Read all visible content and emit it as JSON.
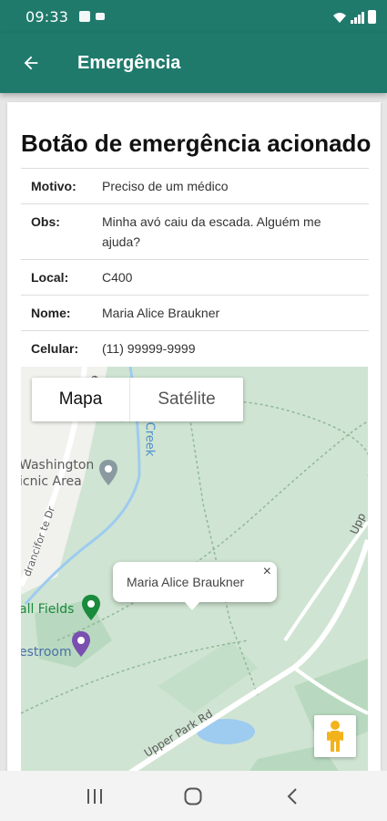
{
  "status_bar": {
    "time": "09:33"
  },
  "app_bar": {
    "title": "Emergência"
  },
  "card": {
    "heading": "Botão de emergência acionado",
    "rows": [
      {
        "label": "Motivo:",
        "value": "Preciso de um médico"
      },
      {
        "label": "Obs:",
        "value": "Minha avó caiu da escada. Alguém me ajuda?"
      },
      {
        "label": "Local:",
        "value": "C400"
      },
      {
        "label": "Nome:",
        "value": "Maria Alice Braukner"
      },
      {
        "label": "Celular:",
        "value": "(11) 99999-9999"
      }
    ]
  },
  "map": {
    "type_control": {
      "map_label": "Mapa",
      "satellite_label": "Satélite",
      "selected": "Mapa"
    },
    "info_window": {
      "text": "Maria Alice Braukner",
      "close_label": "×"
    },
    "labels": {
      "washington_1": "Washington",
      "washington_2": "icnic Area",
      "fields": "all Fields",
      "restroom": "estroom",
      "creek": "Creek",
      "road_left": "drancifor te Dr",
      "road_bottom": "Upper Park Rd",
      "road_right": "Upp",
      "road_top": "e"
    },
    "colors": {
      "park": "#cfe4d2",
      "dark_green": "#b8d9bf",
      "water": "#9ecbf0",
      "road": "#ffffff"
    }
  },
  "nav_bar": {
    "icons": [
      "recent-apps-icon",
      "home-icon",
      "back-nav-icon"
    ]
  },
  "colors": {
    "primary": "#1f7a6c",
    "background": "#e6e6e6",
    "text": "#111111"
  }
}
